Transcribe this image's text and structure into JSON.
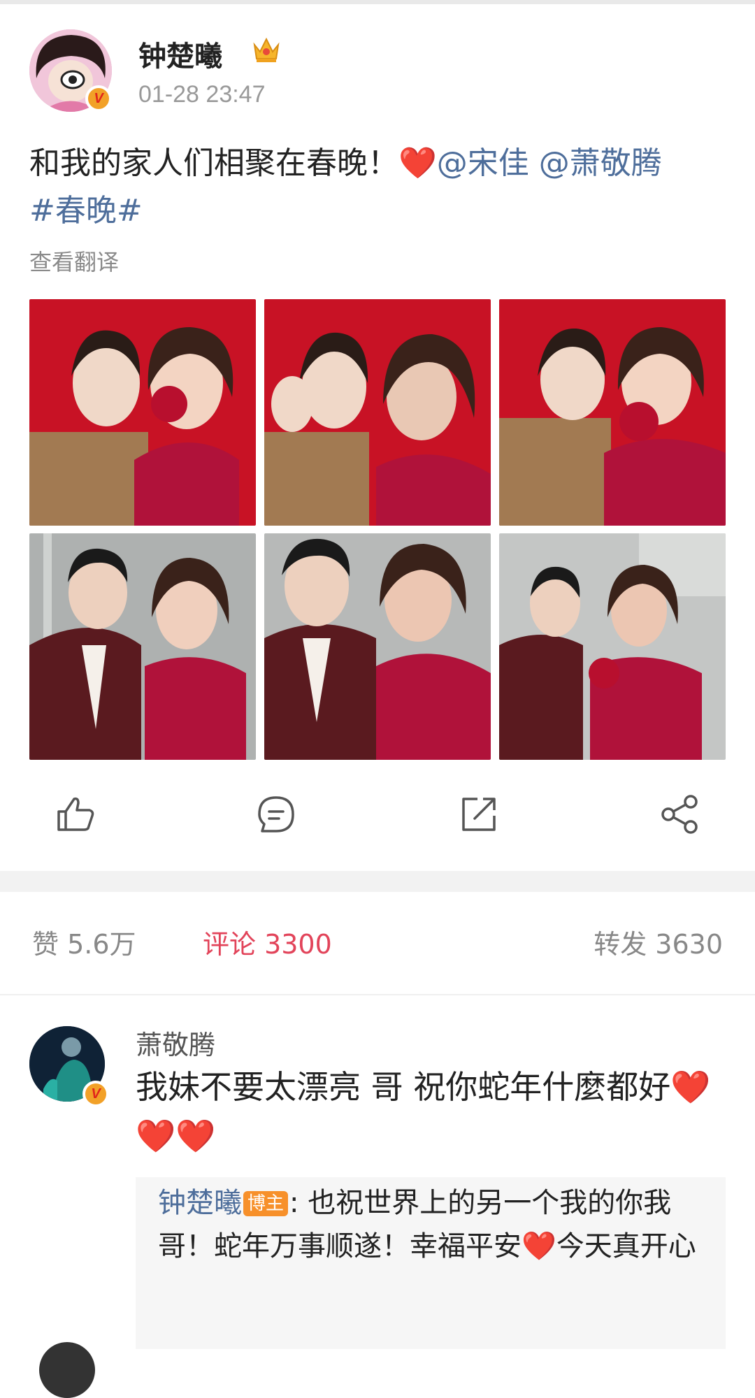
{
  "post": {
    "author": "钟楚曦",
    "time": "01-28 23:47",
    "text_main": "和我的家人们相聚在春晚！",
    "heart": "❤️",
    "mention_1": "@宋佳",
    "mention_2": "@萧敬腾",
    "hashtag": "#春晚#",
    "translate_label": "查看翻译",
    "badge_letter": "V"
  },
  "stats": {
    "likes": "赞 5.6万",
    "comments": "评论 3300",
    "reposts": "转发 3630"
  },
  "comment": {
    "author": "萧敬腾",
    "text": "我妹不要太漂亮 哥 祝你蛇年什麼都好",
    "hearts_inline": "❤️",
    "hearts_tail": "❤️❤️",
    "reply": {
      "author": "钟楚曦",
      "tag": "博主",
      "text_1": ": 也祝世界上的另一个我的你我哥！蛇年万事顺遂！幸福平安",
      "heart": "❤️",
      "text_2": "今天真开心"
    }
  },
  "icons": [
    "like-icon",
    "comment-icon",
    "repost-icon",
    "share-icon",
    "crown-icon",
    "verified-badge-icon"
  ],
  "colors": {
    "link": "#4e6e9b",
    "accent": "#e2445a",
    "badge": "#f2a128"
  }
}
